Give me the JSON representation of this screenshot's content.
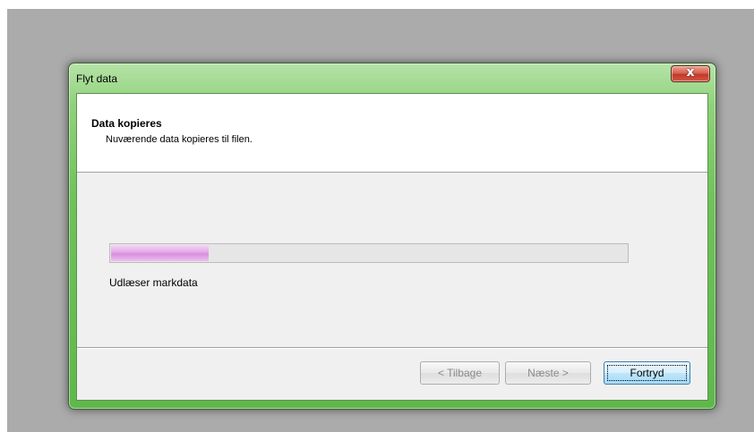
{
  "window": {
    "title": "Flyt data",
    "close_label": "x"
  },
  "header": {
    "title": "Data kopieres",
    "subtitle": "Nuværende data kopieres til filen."
  },
  "progress": {
    "value_fraction": 0.19,
    "fill_color": "#e0a8e6"
  },
  "status": {
    "text": "Udlæser markdata"
  },
  "buttons": {
    "back_label": "< Tilbage",
    "next_label": "Næste >",
    "cancel_label": "Fortryd"
  }
}
